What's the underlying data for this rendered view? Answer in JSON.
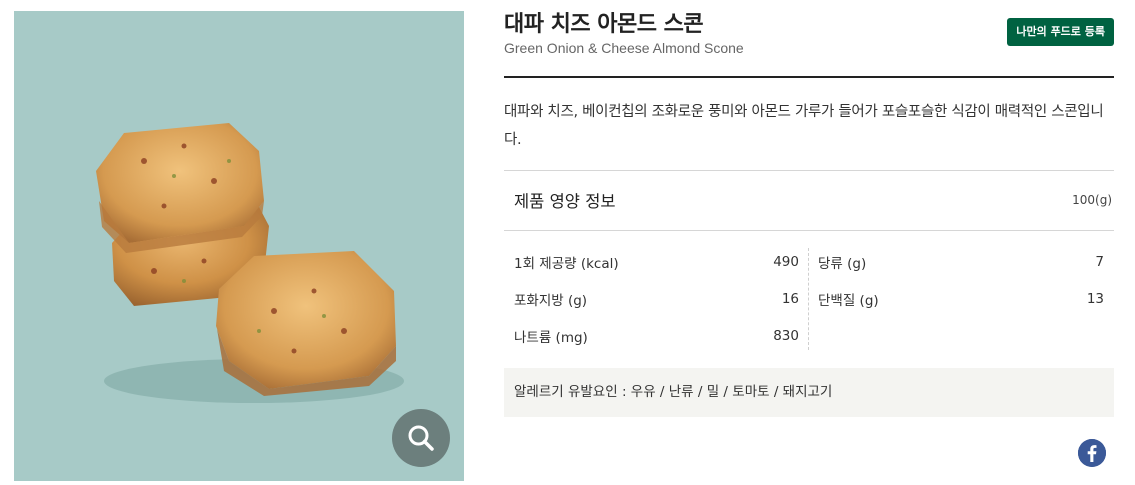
{
  "product": {
    "name_ko": "대파 치즈 아몬드 스콘",
    "name_en": "Green Onion & Cheese Almond Scone",
    "my_food_button": "나만의 푸드로 등록",
    "description": "대파와 치즈, 베이컨칩의 조화로운 풍미와 아몬드 가루가 들어가 포슬포슬한 식감이 매력적인 스콘입니다."
  },
  "image": {
    "background": "#a7cac7",
    "zoom_icon": "magnifier-icon"
  },
  "nutrition": {
    "title": "제품 영양 정보",
    "serving": "100(g)",
    "left": [
      {
        "label": "1회 제공량 (kcal)",
        "value": "490"
      },
      {
        "label": "포화지방 (g)",
        "value": "16"
      },
      {
        "label": "나트륨 (mg)",
        "value": "830"
      }
    ],
    "right": [
      {
        "label": "당류 (g)",
        "value": "7"
      },
      {
        "label": "단백질 (g)",
        "value": "13"
      }
    ]
  },
  "allergy": "알레르기 유발요인 : 우유 / 난류 / 밀 / 토마토 / 돼지고기",
  "share": {
    "facebook_icon": "facebook-icon"
  },
  "colors": {
    "brand_green": "#006241",
    "facebook": "#3b5998"
  }
}
